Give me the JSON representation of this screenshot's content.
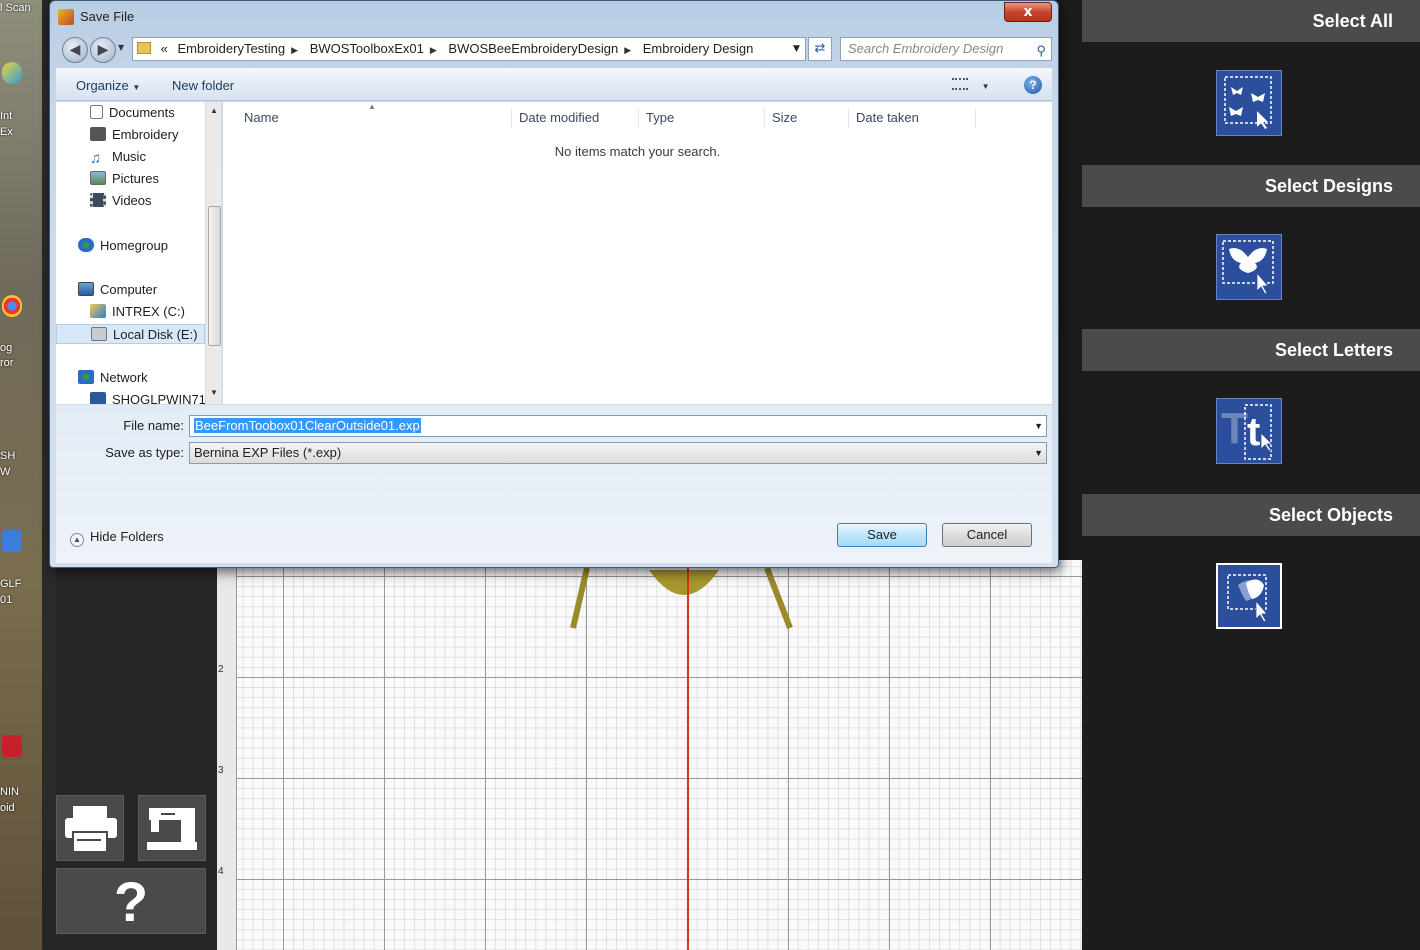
{
  "desktop": {
    "top_label": "l Scan",
    "side_labels": [
      "Int",
      "Ex",
      "og",
      "ror",
      "SH",
      "W",
      "GLF",
      "01",
      "NIN",
      "oid"
    ]
  },
  "app": {
    "help_glyph": "?",
    "ruler_numbers": [
      "2",
      "3",
      "4"
    ],
    "right_panel": {
      "items": [
        {
          "label": "Select All",
          "icon": "butterflies-select-all-icon"
        },
        {
          "label": "Select Designs",
          "icon": "butterfly-select-design-icon"
        },
        {
          "label": "Select Letters",
          "icon": "letter-t-select-icon"
        },
        {
          "label": "Select Objects",
          "icon": "object-select-icon"
        }
      ],
      "selected_index": 3
    }
  },
  "dialog": {
    "title": "Save File",
    "close_glyph": "x",
    "address": {
      "prefix": "«",
      "crumbs": [
        "EmbroideryTesting",
        "BWOSToolboxEx01",
        "BWOSBeeEmbroideryDesign",
        "Embroidery Design"
      ]
    },
    "search_placeholder": "Search Embroidery Design",
    "toolbar": {
      "organize": "Organize",
      "new_folder": "New folder"
    },
    "nav_items": [
      {
        "label": "Documents",
        "icon": "documents-icon"
      },
      {
        "label": "Embroidery",
        "icon": "embroidery-icon"
      },
      {
        "label": "Music",
        "icon": "music-icon"
      },
      {
        "label": "Pictures",
        "icon": "pictures-icon"
      },
      {
        "label": "Videos",
        "icon": "videos-icon"
      },
      {
        "label": "Homegroup",
        "icon": "homegroup-icon"
      },
      {
        "label": "Computer",
        "icon": "computer-icon"
      },
      {
        "label": "INTREX (C:)",
        "icon": "drive-c-icon"
      },
      {
        "label": "Local Disk (E:)",
        "icon": "drive-e-icon"
      },
      {
        "label": "Network",
        "icon": "network-icon"
      },
      {
        "label": "SHOGLPWIN71",
        "icon": "network-computer-icon"
      }
    ],
    "columns": [
      "Name",
      "Date modified",
      "Type",
      "Size",
      "Date taken"
    ],
    "empty_message": "No items match your search.",
    "file_name_label": "File name:",
    "file_name_value": "BeeFromToobox01ClearOutside01.exp",
    "save_type_label": "Save as type:",
    "save_type_value": "Bernina EXP Files (*.exp)",
    "hide_folders": "Hide Folders",
    "save_button": "Save",
    "cancel_button": "Cancel",
    "colors": {
      "accent": "#3399ff",
      "title_bar": "#b8cde4",
      "close": "#c8452a"
    }
  }
}
